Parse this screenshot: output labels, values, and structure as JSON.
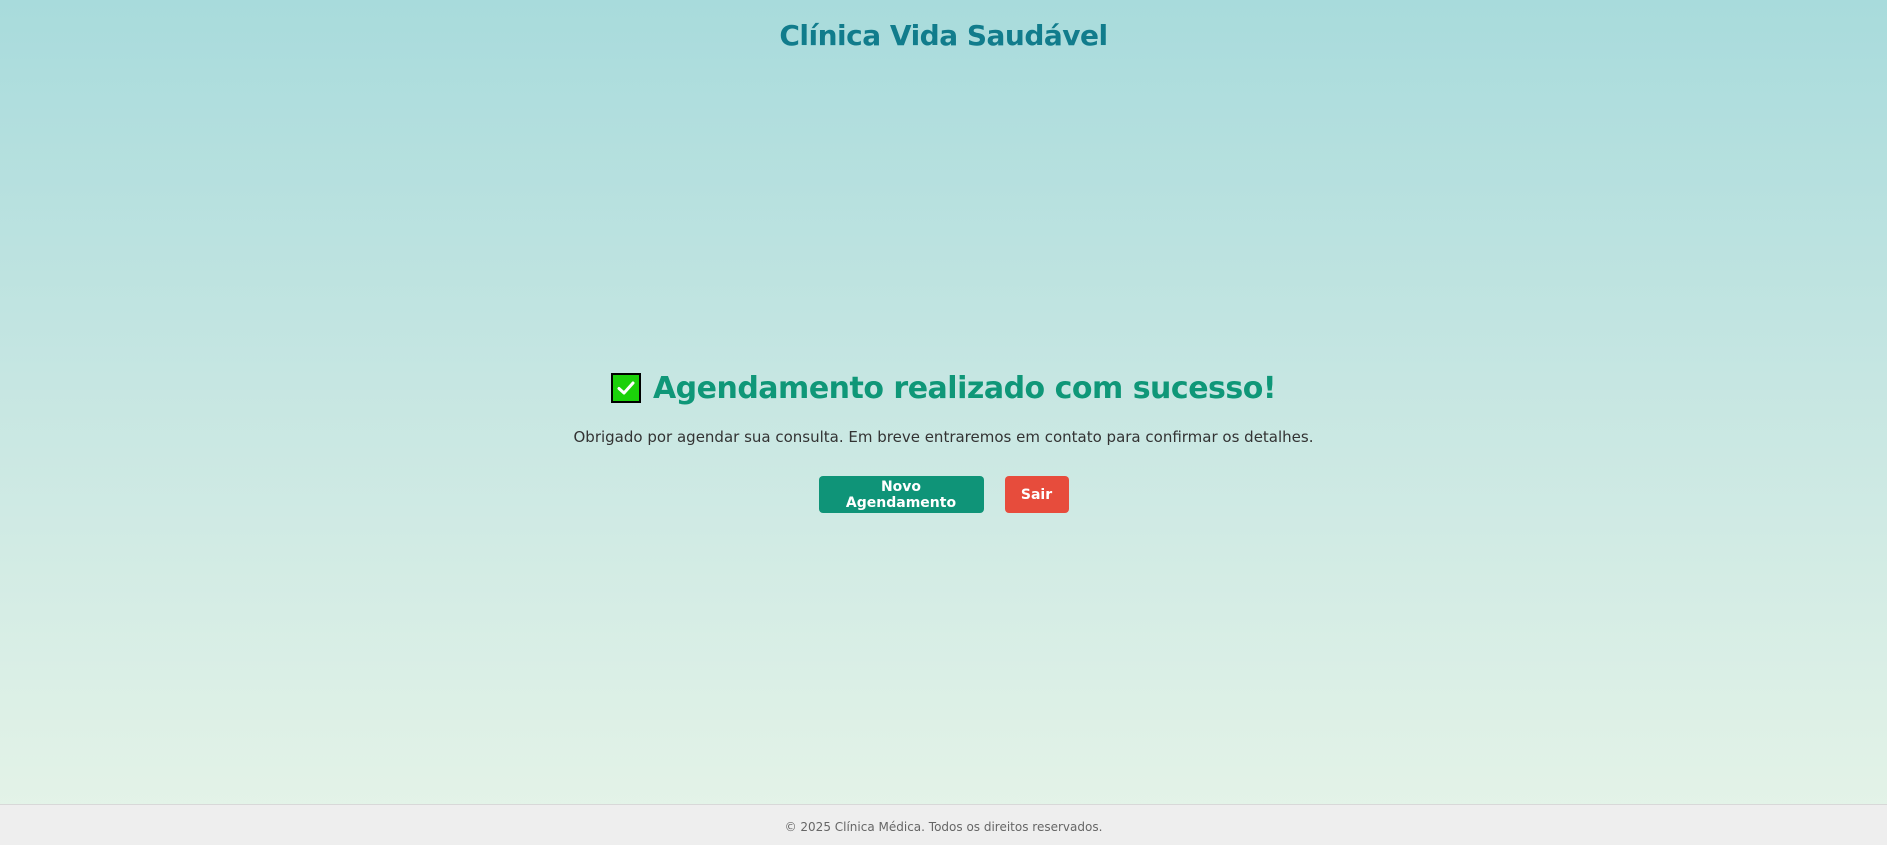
{
  "header": {
    "title": "Clínica Vida Saudável",
    "color": "#117c8c"
  },
  "confirmation": {
    "icon": "check-mark-icon",
    "title": "Agendamento realizado com sucesso!",
    "message": "Obrigado por agendar sua consulta. Em breve entraremos em contato para confirmar os detalhes.",
    "title_color": "#0f9778"
  },
  "actions": {
    "new_booking_label": "Novo Agendamento",
    "new_booking_color": "#0f9478",
    "exit_label": "Sair",
    "exit_color": "#e74c3c"
  },
  "footer": {
    "copyright": "© 2025 Clínica Médica. Todos os direitos reservados."
  }
}
